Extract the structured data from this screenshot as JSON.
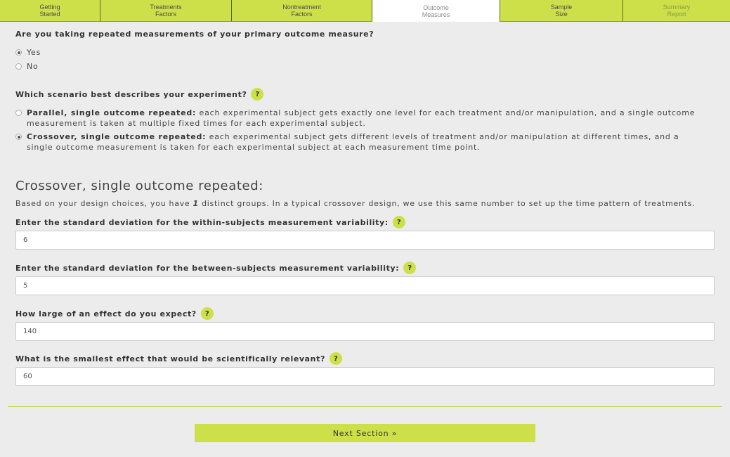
{
  "tabs": [
    {
      "label": "Getting\nStarted"
    },
    {
      "label": "Treatments\nFactors"
    },
    {
      "label": "Nontreatment\nFactors"
    },
    {
      "label": "Outcome\nMeasures"
    },
    {
      "label": "Sample\nSize"
    },
    {
      "label": "Summary\nReport"
    }
  ],
  "repeated": {
    "question": "Are you taking repeated measurements of your primary outcome measure?",
    "options": [
      "Yes",
      "No"
    ],
    "selected": "Yes"
  },
  "scenario": {
    "question": "Which scenario best describes your experiment?",
    "help": "?",
    "options": [
      {
        "title": "Parallel, single outcome repeated:",
        "text": " each experimental subject gets exactly one level for each treatment and/or manipulation, and a single outcome measurement is taken at multiple fixed times for each experimental subject."
      },
      {
        "title": "Crossover, single outcome repeated:",
        "text": " each experimental subject gets different levels of treatment and/or manipulation at different times, and a single outcome measurement is taken for each experimental subject at each measurement time point."
      }
    ],
    "selected": "Crossover, single outcome repeated:"
  },
  "crossover": {
    "heading": "Crossover, single outcome repeated:",
    "info_prefix": "Based on your design choices, you have ",
    "groups": "1",
    "info_suffix": " distinct groups. In a typical crossover design, we use this same number to set up the time pattern of treatments."
  },
  "fields": {
    "within_sd": {
      "label": "Enter the standard deviation for the within-subjects measurement variability:",
      "value": "6",
      "help": "?"
    },
    "between_sd": {
      "label": "Enter the standard deviation for the between-subjects measurement variability:",
      "value": "5",
      "help": "?"
    },
    "effect": {
      "label": "How large of an effect do you expect?",
      "value": "140",
      "help": "?"
    },
    "smallest_effect": {
      "label": "What is the smallest effect that would be scientifically relevant?",
      "value": "60",
      "help": "?"
    }
  },
  "next_button": "Next Section »"
}
